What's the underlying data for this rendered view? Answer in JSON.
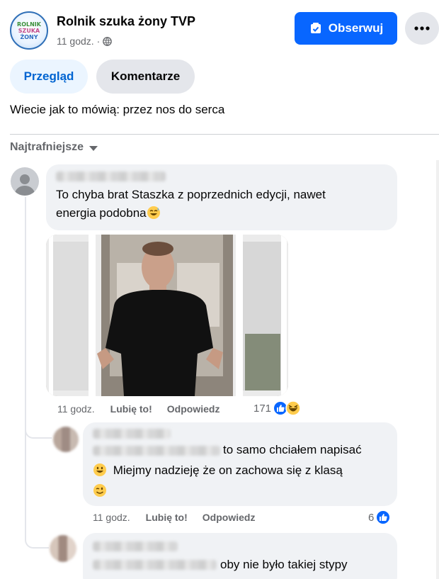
{
  "post": {
    "page_name": "Rolnik szuka żony TVP",
    "page_logo_text": [
      "ROLNIK",
      "SZUKA",
      "ŻONY"
    ],
    "time": "11 godz.",
    "separator": "·",
    "privacy_icon": "globe-icon",
    "follow_label": "Obserwuj",
    "more_icon": "ellipsis-icon",
    "text": "Wiecie jak to mówią: przez nos do serca"
  },
  "tabs": [
    {
      "label": "Przegląd",
      "active": true
    },
    {
      "label": "Komentarze",
      "active": false
    }
  ],
  "sort": {
    "label": "Najtrafniejsze",
    "icon": "caret-down-icon"
  },
  "comments": [
    {
      "text_line1": "To chyba brat Staszka z poprzednich edycji, nawet",
      "text_line2": "energia podobna",
      "emoji": "grinning-sweat-emoji",
      "time": "11 godz.",
      "like": "Lubię to!",
      "reply": "Odpowiedz",
      "reaction_count": "171",
      "reactions": [
        "like",
        "laughing"
      ]
    },
    {
      "text_line1": "to samo chciałem napisać",
      "text_line2": "Miejmy nadzieję że on zachowa się z klasą",
      "emoji_before_line2": "grinning-emoji",
      "emoji_line3": "wink-emoji",
      "time": "11 godz.",
      "like": "Lubię to!",
      "reply": "Odpowiedz",
      "reaction_count": "6",
      "reactions": [
        "like"
      ]
    },
    {
      "text_line1": "oby nie było takiej stypy"
    }
  ],
  "colors": {
    "accent": "#0866ff",
    "tab_active_bg": "#ebf5ff",
    "tab_active_text": "#0064d1",
    "bubble": "#f0f2f5",
    "secondary_text": "#65676b"
  }
}
